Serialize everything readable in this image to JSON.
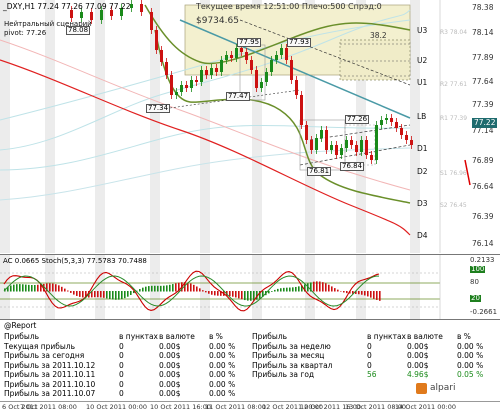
{
  "main_chart": {
    "header": "_DXY,H1  77.24 77.26 77.09 77.22",
    "info_left": "Нейтральный сценарий\npivot: 77.26",
    "info_top": "Текущее время 12:51:00 Плечо:500  Спрэд:0",
    "balance": "$9734.65",
    "level_box_value": "38.2",
    "price_scale": [
      "78.38",
      "78.14",
      "77.89",
      "77.64",
      "77.39",
      "77.14",
      "76.89",
      "76.64",
      "76.39",
      "76.14"
    ],
    "current_price": "77.22",
    "levels": [
      {
        "name": "U3",
        "label": "R3 78.04"
      },
      {
        "name": "U2",
        "label": ""
      },
      {
        "name": "U1",
        "label": "R2 77.61"
      },
      {
        "name": "LB",
        "label": "R1 77.39"
      },
      {
        "name": "D1",
        "label": ""
      },
      {
        "name": "D2",
        "label": "S1 76.96"
      },
      {
        "name": "D3",
        "label": "S2 76.45"
      },
      {
        "name": "D4",
        "label": ""
      }
    ],
    "price_labels": [
      "78.08",
      "77.95",
      "77.93",
      "77.47",
      "77.34",
      "77.26",
      "76.81",
      "76.84"
    ]
  },
  "indicator": {
    "header": "AC 0.0665  Stoch(5,3,3) 77.5783 70.7488",
    "scale": [
      "80",
      "20"
    ],
    "scale_top": "100",
    "scale_low": "-0.2661",
    "scale_right_top": "0.2133"
  },
  "report": {
    "title": "@Report",
    "columns_left": [
      "Прибыль",
      "в пунктах",
      "в валюте",
      "в %"
    ],
    "rows_left": [
      [
        "Текущая прибыль",
        "0",
        "0.00$",
        "0.00 %"
      ],
      [
        "Прибыль за сегодня",
        "0",
        "0.00$",
        "0.00 %"
      ],
      [
        "Прибыль за 2011.10.12",
        "0",
        "0.00$",
        "0.00 %"
      ],
      [
        "Прибыль за 2011.10.11",
        "0",
        "0.00$",
        "0.00 %"
      ],
      [
        "Прибыль за 2011.10.10",
        "0",
        "0.00$",
        "0.00 %"
      ],
      [
        "Прибыль за 2011.10.07",
        "0",
        "0.00$",
        "0.00 %"
      ]
    ],
    "columns_right": [
      "Прибыль",
      "в пунктах",
      "в валюте",
      "в %"
    ],
    "rows_right": [
      [
        "Прибыль за неделю",
        "0",
        "0.00$",
        "0.00 %"
      ],
      [
        "Прибыль за месяц",
        "0",
        "0.00$",
        "0.00 %"
      ],
      [
        "Прибыль за квартал",
        "0",
        "0.00$",
        "0.00 %"
      ],
      [
        "Прибыль за год",
        "56",
        "4.96$",
        "0.05 %"
      ]
    ],
    "brand": "alpari"
  },
  "time_axis": [
    "6 Oct 2011",
    "7 Oct 2011 08:00",
    "10 Oct 2011 00:00",
    "10 Oct 2011 16:00",
    "11 Oct 2011 08:00",
    "12 Oct 2011 00:00",
    "12 Oct 2011 16:00",
    "13 Oct 2011 08:00",
    "14 Oct 2011 00:00"
  ]
}
